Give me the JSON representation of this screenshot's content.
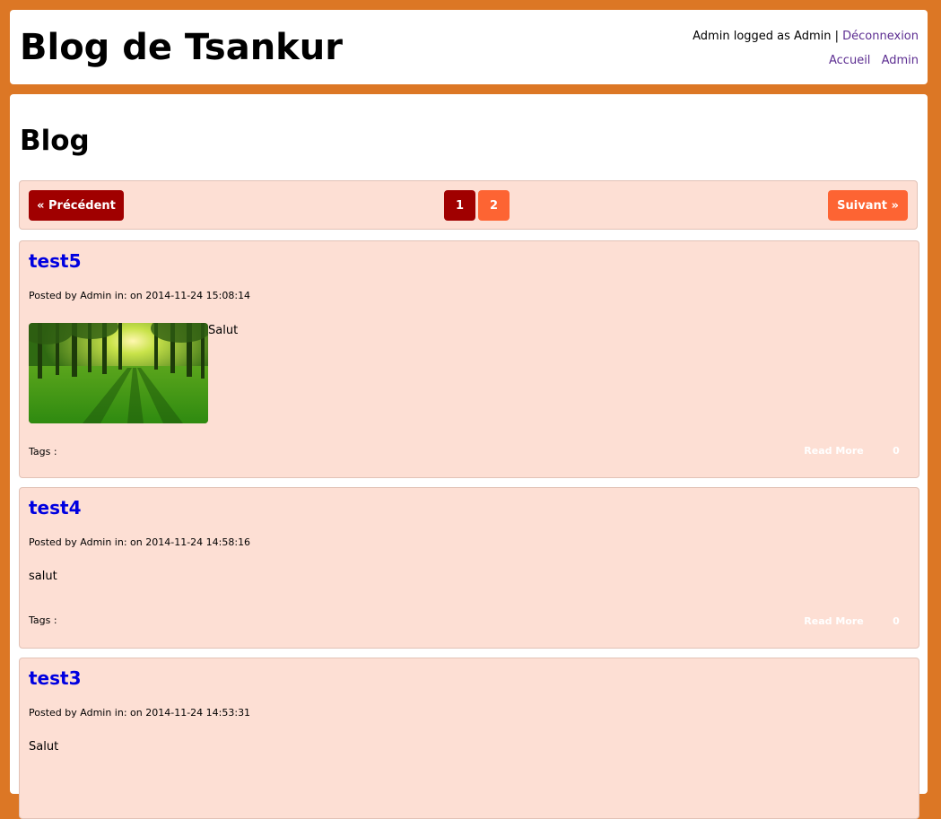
{
  "header": {
    "site_title": "Blog de Tsankur",
    "user_text": "Admin logged as Admin",
    "separator": "|",
    "logout": "Déconnexion",
    "nav": [
      "Accueil",
      "Admin"
    ]
  },
  "main": {
    "heading": "Blog"
  },
  "pagination": {
    "prev": "« Précédent",
    "pages": [
      "1",
      "2"
    ],
    "current_page": "1",
    "next": "Suivant »"
  },
  "posts": [
    {
      "title": "test5",
      "meta": "Posted by Admin in: on 2014-11-24 15:08:14",
      "body": "Salut",
      "has_image": true,
      "tags_label": "Tags :",
      "read_more": "Read More",
      "comments": "0"
    },
    {
      "title": "test4",
      "meta": "Posted by Admin in: on 2014-11-24 14:58:16",
      "body": "salut",
      "has_image": false,
      "tags_label": "Tags :",
      "read_more": "Read More",
      "comments": "0"
    },
    {
      "title": "test3",
      "meta": "Posted by Admin in: on 2014-11-24 14:53:31",
      "body": "Salut",
      "has_image": false
    }
  ],
  "colors": {
    "page_bg": "#dc7725",
    "panel_bg": "#fddfd4",
    "btn_dark": "#a00000",
    "btn_orange": "#fd6433",
    "link_purple": "#5c2d91",
    "title_blue": "#0000e0"
  }
}
